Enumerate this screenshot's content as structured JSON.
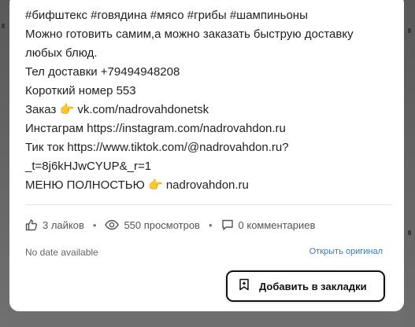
{
  "post": {
    "lines": [
      "#бифштекс #говядина #мясо #грибы #шампиньоны",
      "Можно готовить самим,а можно заказать быструю доставку",
      "любых блюд.",
      "Тел доставки +79494948208",
      "Короткий номер 553"
    ],
    "order_prefix": "Заказ",
    "order_emoji": "👉",
    "order_link": "vk.com/nadrovahdonetsk",
    "instagram_line": "Инстаграм https://instagram.com/nadrovahdon.ru",
    "tiktok_line_1": "Тик ток https://www.tiktok.com/@nadrovahdon.ru?",
    "tiktok_line_2": "_t=8j6kHJwCYUP&_r=1",
    "menu_prefix": "МЕНЮ ПОЛНОСТЬЮ",
    "menu_emoji": "👉",
    "menu_link": "nadrovahdon.ru"
  },
  "stats": {
    "likes": "3 лайков",
    "views": "550 просмотров",
    "comments": "0 комментариев"
  },
  "footer": {
    "date": "No date available",
    "open_original": "Открыть оригинал"
  },
  "actions": {
    "bookmark_label": "Добавить в закладки"
  },
  "colors": {
    "link": "#3a78c9",
    "overlay": "#6f6f6f",
    "card": "#ffffff"
  },
  "icons": {
    "likes": "thumbs-up-icon",
    "views": "eye-icon",
    "comments": "comment-icon",
    "bookmark": "bookmark-add-icon"
  }
}
